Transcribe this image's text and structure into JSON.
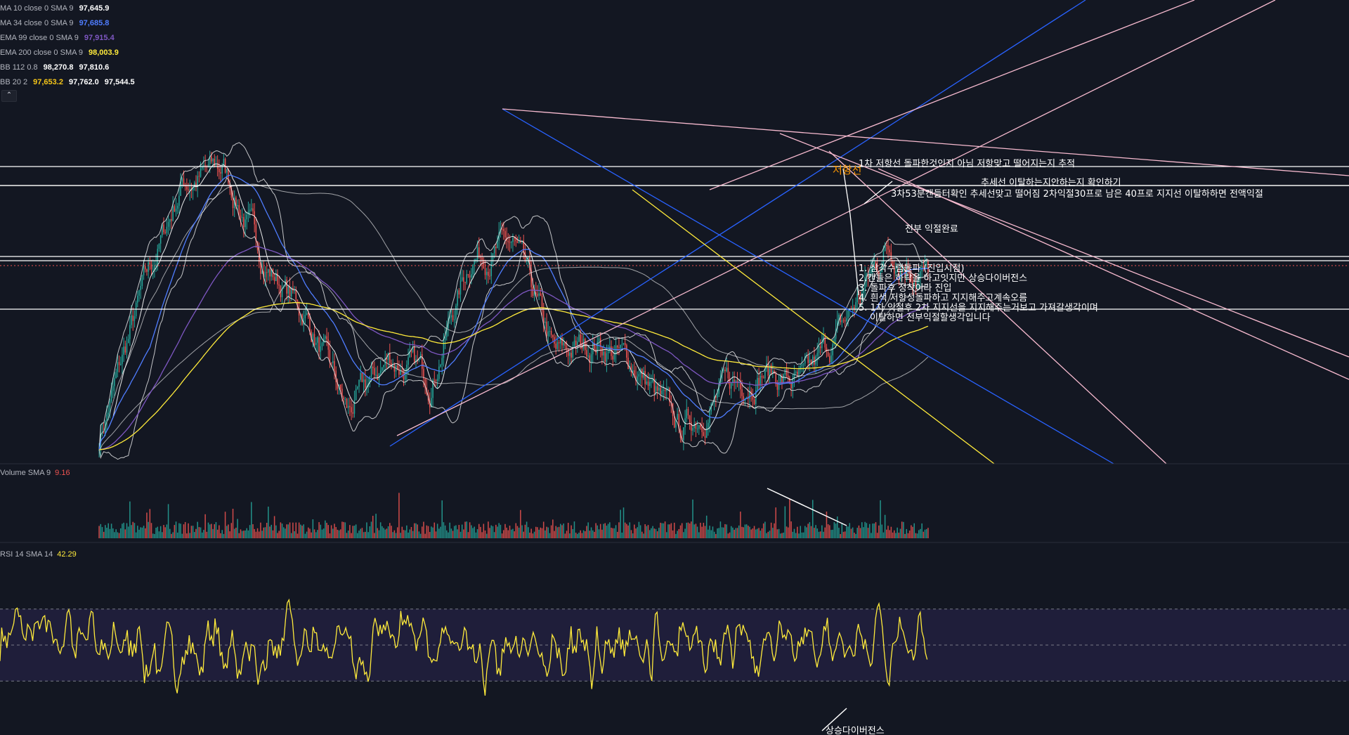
{
  "legend": [
    {
      "name": "MA 10 close 0 SMA 9",
      "values": [
        "97,645.9"
      ],
      "colors": [
        "#ffffff"
      ]
    },
    {
      "name": "MA 34 close 0 SMA 9",
      "values": [
        "97,685.8"
      ],
      "colors": [
        "#4f7dff"
      ]
    },
    {
      "name": "EMA 99 close 0 SMA 9",
      "values": [
        "97,915.4"
      ],
      "colors": [
        "#7e57c2"
      ]
    },
    {
      "name": "EMA 200 close 0 SMA 9",
      "values": [
        "98,003.9"
      ],
      "colors": [
        "#ffeb3b"
      ]
    },
    {
      "name": "BB 112 0.8",
      "values": [
        "98,270.8",
        "97,810.6"
      ],
      "colors": [
        "#ffffff",
        "#ffffff"
      ]
    },
    {
      "name": "BB 20 2",
      "values": [
        "97,653.2",
        "97,762.0",
        "97,544.5"
      ],
      "colors": [
        "#f5c518",
        "#ffffff",
        "#ffffff"
      ]
    }
  ],
  "collapse_icon": "chevron-up-icon",
  "volume_label": {
    "name": "Volume SMA 9",
    "value": "9.16",
    "color": "#ef5350"
  },
  "rsi_label": {
    "name": "RSI 14 SMA 14",
    "value": "42.29",
    "color": "#ffeb3b"
  },
  "annotations": {
    "resistance": "저항선",
    "note1": "1차 저항선 돌파한것인지 아님 저항맞고 떨어지는지 추적",
    "note2": "추세선 이탈하는지안하는지 확인하기",
    "note3": "3차53분캔들터확인 추세선맞고 떨어짐 2차익절30프로 남은 40프로 지지선 이탈하하면 전액익절",
    "note4": "전부 익절완료",
    "steps": [
      "1. 삼각수렴돌파 (진입시점)",
      "2.캔들은 하락을 하고잇지만 상승다이버전스",
      "3. 돌파후 정착이라 진입",
      "4. 흰색 저항성돌파하고 지지해주고계속오름",
      "5. 1차 익절후 2차 지지선을 지지해주는거보고 가져갈생각이며",
      "이탈하면 전부익절할생각입니다"
    ],
    "divergence": "상승다이버전스"
  },
  "colors": {
    "background": "#131722",
    "candle_up": "#26a69a",
    "candle_down": "#ef5350",
    "ma10": "#ffffff",
    "ma34": "#4f7dff",
    "ema99": "#7e57c2",
    "ema200": "#ffeb3b",
    "rsi": "#ffeb3b",
    "rsi_band": "#1f1e3a",
    "trend_blue": "#2962ff",
    "trend_pink": "#f8bbd0",
    "trend_yellow": "#ffeb3b",
    "horizontal": "#ffffff",
    "annotation_orange": "#ff9800"
  },
  "chart_data": [
    {
      "type": "candlestick",
      "title": "",
      "indicators": [
        "MA 10",
        "MA 34",
        "EMA 99",
        "EMA 200",
        "BB 112 0.8",
        "BB 20 2"
      ],
      "price_path_relative": [
        [
          0,
          0.05
        ],
        [
          0.05,
          0.45
        ],
        [
          0.1,
          0.78
        ],
        [
          0.15,
          0.82
        ],
        [
          0.2,
          0.55
        ],
        [
          0.25,
          0.4
        ],
        [
          0.3,
          0.12
        ],
        [
          0.35,
          0.28
        ],
        [
          0.4,
          0.22
        ],
        [
          0.45,
          0.58
        ],
        [
          0.5,
          0.6
        ],
        [
          0.55,
          0.28
        ],
        [
          0.6,
          0.33
        ],
        [
          0.65,
          0.25
        ],
        [
          0.7,
          0.07
        ],
        [
          0.75,
          0.18
        ],
        [
          0.8,
          0.25
        ],
        [
          0.85,
          0.2
        ],
        [
          0.9,
          0.38
        ],
        [
          0.95,
          0.6
        ],
        [
          1.0,
          0.52
        ]
      ]
    },
    {
      "type": "bar",
      "title": "Volume",
      "ylabel": "",
      "grid": false
    },
    {
      "type": "line",
      "title": "RSI",
      "ylim": [
        0,
        100
      ],
      "band": [
        30,
        70
      ],
      "midline": 50,
      "grid": false
    }
  ]
}
